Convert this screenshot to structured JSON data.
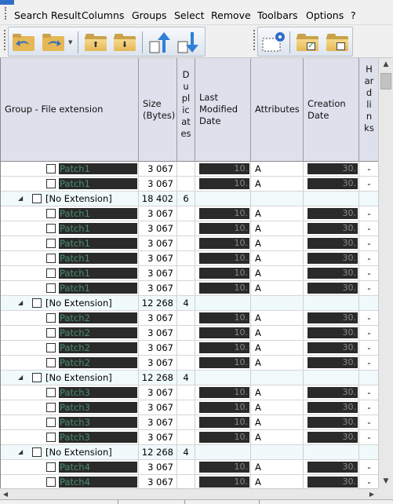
{
  "menu": [
    "Search Result",
    "Columns",
    "Groups",
    "Select",
    "Remove",
    "Toolbars",
    "Options",
    "?"
  ],
  "columns": {
    "group": "Group - File extension",
    "size": "Size\n(Bytes)",
    "duplicates": "D\nu\npl\nic\nat\nes",
    "modified": "Last\nModified\nDate",
    "attributes": "Attributes",
    "created": "Creation\nDate",
    "hardlinks": "H\nar\nd\nli\nn\nks"
  },
  "rows": [
    {
      "type": "file",
      "name": "Patch1",
      "size": "3 067",
      "modified": "10.",
      "attr": "A",
      "created": "30.",
      "hard": "-"
    },
    {
      "type": "file",
      "name": "Patch1",
      "size": "3 067",
      "modified": "10.",
      "attr": "A",
      "created": "30.",
      "hard": "-"
    },
    {
      "type": "group",
      "name": "[No Extension]",
      "size": "18 402",
      "dups": "6"
    },
    {
      "type": "file",
      "name": "Patch1",
      "size": "3 067",
      "modified": "10.",
      "attr": "A",
      "created": "30.",
      "hard": "-"
    },
    {
      "type": "file",
      "name": "Patch1",
      "size": "3 067",
      "modified": "10.",
      "attr": "A",
      "created": "30.",
      "hard": "-"
    },
    {
      "type": "file",
      "name": "Patch1",
      "size": "3 067",
      "modified": "10.",
      "attr": "A",
      "created": "30.",
      "hard": "-"
    },
    {
      "type": "file",
      "name": "Patch1",
      "size": "3 067",
      "modified": "10.",
      "attr": "A",
      "created": "30.",
      "hard": "-"
    },
    {
      "type": "file",
      "name": "Patch1",
      "size": "3 067",
      "modified": "10.",
      "attr": "A",
      "created": "30.",
      "hard": "-"
    },
    {
      "type": "file",
      "name": "Patch1",
      "size": "3 067",
      "modified": "10.",
      "attr": "A",
      "created": "30.",
      "hard": "-"
    },
    {
      "type": "group",
      "name": "[No Extension]",
      "size": "12 268",
      "dups": "4"
    },
    {
      "type": "file",
      "name": "Patch2",
      "size": "3 067",
      "modified": "10.",
      "attr": "A",
      "created": "30.",
      "hard": "-"
    },
    {
      "type": "file",
      "name": "Patch2",
      "size": "3 067",
      "modified": "10.",
      "attr": "A",
      "created": "30.",
      "hard": "-"
    },
    {
      "type": "file",
      "name": "Patch2",
      "size": "3 067",
      "modified": "10.",
      "attr": "A",
      "created": "30.",
      "hard": "-"
    },
    {
      "type": "file",
      "name": "Patch2",
      "size": "3 067",
      "modified": "10.",
      "attr": "A",
      "created": "30.",
      "hard": "-"
    },
    {
      "type": "group",
      "name": "[No Extension]",
      "size": "12 268",
      "dups": "4"
    },
    {
      "type": "file",
      "name": "Patch3",
      "size": "3 067",
      "modified": "10.",
      "attr": "A",
      "created": "30.",
      "hard": "-"
    },
    {
      "type": "file",
      "name": "Patch3",
      "size": "3 067",
      "modified": "10.",
      "attr": "A",
      "created": "30.",
      "hard": "-"
    },
    {
      "type": "file",
      "name": "Patch3",
      "size": "3 067",
      "modified": "10.",
      "attr": "A",
      "created": "30.",
      "hard": "-"
    },
    {
      "type": "file",
      "name": "Patch3",
      "size": "3 067",
      "modified": "10.",
      "attr": "A",
      "created": "30.",
      "hard": "-"
    },
    {
      "type": "group",
      "name": "[No Extension]",
      "size": "12 268",
      "dups": "4"
    },
    {
      "type": "file",
      "name": "Patch4",
      "size": "3 067",
      "modified": "10.",
      "attr": "A",
      "created": "30.",
      "hard": "-"
    },
    {
      "type": "file",
      "name": "Patch4",
      "size": "3 067",
      "modified": "10.",
      "attr": "A",
      "created": "30.",
      "hard": "-"
    }
  ],
  "toolbar_icons": [
    "undo-icon",
    "redo-icon",
    "folder-up-icon",
    "folder-down-icon",
    "move-up-icon",
    "move-down-icon",
    "select-settings-icon",
    "folder-check-icon",
    "folder-uncheck-icon"
  ],
  "colors": {
    "header_bg": "#dee0ec",
    "group_row_bg": "#f0fafb",
    "masked_bg": "#2a2a2a",
    "filename_text": "#4a8f6e",
    "accent_blue": "#2f6dc7"
  }
}
